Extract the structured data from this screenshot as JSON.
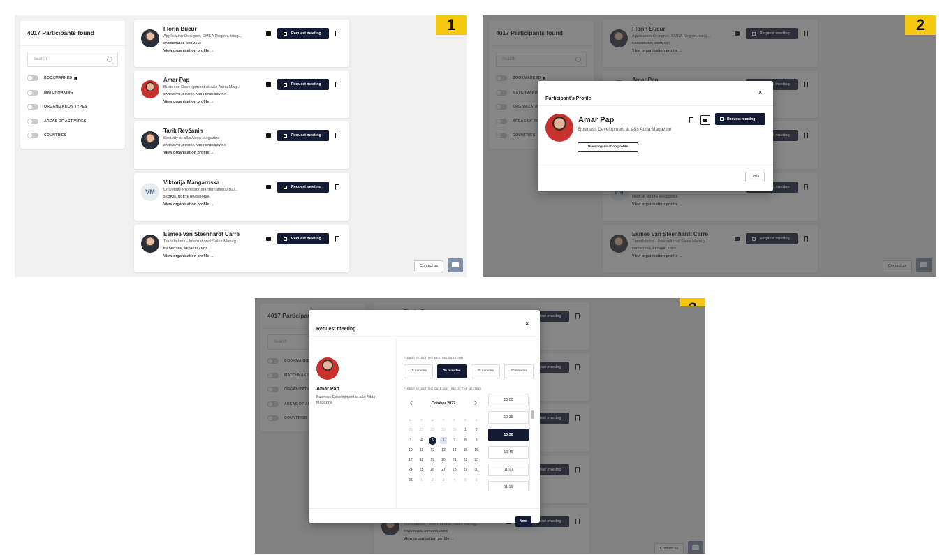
{
  "panels": [
    {
      "badge": "1",
      "filters": {
        "title": "4017 Participants found",
        "search_placeholder": "Search",
        "toggles": [
          "BOOKMARKED",
          "MATCHMAKING",
          "ORGANIZATION TYPES",
          "AREAS OF ACTIVITIES",
          "COUNTRIES"
        ]
      },
      "cards": [
        {
          "name": "Florin Bucur",
          "role": "Application Designer, EMEA Region, Ising...",
          "location": "CANGBRUNN, GERMANY",
          "link": "View organisation profile →",
          "request": "Request meeting"
        },
        {
          "name": "Amar Pap",
          "role": "Business Development at a&s Adria Mag...",
          "location": "SARAJEVO, BOSNIA AND HERZEGOVINA",
          "link": "View organisation profile →",
          "request": "Request meeting"
        },
        {
          "name": "Tarik Revčanin",
          "role": "Security at a&s Adria Magazine",
          "location": "SARAJEVO, BOSNIA AND HERZEGOVINA",
          "link": "View organisation profile →",
          "request": "Request meeting"
        },
        {
          "name": "Viktorija Mangaroska",
          "initials": "VM",
          "role": "University Professor at International Bal...",
          "location": "SKOPJE, NORTH MACEDONIA",
          "link": "View organisation profile →",
          "request": "Request meeting"
        },
        {
          "name": "Esmee van Steenhardt Carre",
          "role": "Translations - International Sales Manag...",
          "location": "EINDHOVEN, NETHERLANDS",
          "link": "View organisation profile →",
          "request": "Request meeting"
        }
      ],
      "contact": "Contact us"
    },
    {
      "badge": "2",
      "modal": {
        "title": "Participant's Profile",
        "close_x": "×",
        "name": "Amar Pap",
        "role": "Business Development at a&s Adria Magazine",
        "org_button": "View organisation profile",
        "request": "Request meeting",
        "close_button": "Close"
      }
    },
    {
      "badge": "3",
      "modal": {
        "title": "Request meeting",
        "close_x": "×",
        "name": "Amar Pap",
        "role": "Business Development at a&s Adria Magazine",
        "duration_label": "PLEASE SELECT THE MEETING DURATION",
        "durations": [
          "15 minutes",
          "30 minutes",
          "45 minutes",
          "60 minutes"
        ],
        "selected_duration": "30 minutes",
        "date_label": "PLEASE SELECT THE DATE AND TIME OF THE MEETING",
        "month": "October 2022",
        "weekdays": [
          "M",
          "T",
          "W",
          "T",
          "F",
          "S",
          "S"
        ],
        "days": [
          "26",
          "27",
          "28",
          "29",
          "30",
          "1",
          "2",
          "3",
          "4",
          "5",
          "6",
          "7",
          "8",
          "9",
          "10",
          "11",
          "12",
          "13",
          "14",
          "15",
          "16",
          "17",
          "18",
          "19",
          "20",
          "21",
          "22",
          "23",
          "24",
          "25",
          "26",
          "27",
          "28",
          "29",
          "30",
          "31",
          "1",
          "2",
          "3",
          "4",
          "5",
          "6"
        ],
        "selected_day": "5",
        "today": "6",
        "times": [
          "10:00",
          "10:15",
          "10:30",
          "10:45",
          "11:00",
          "11:15"
        ],
        "selected_time": "10:30",
        "next": "Next"
      }
    }
  ]
}
